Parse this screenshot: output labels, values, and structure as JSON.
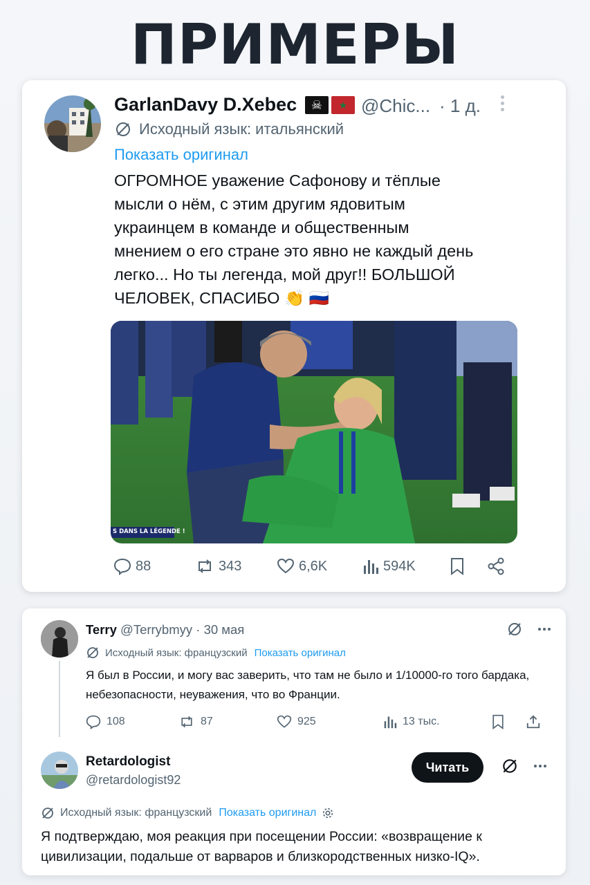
{
  "heading": "ПРИМЕРЫ",
  "tweet1": {
    "name": "GarlanDavy D.Xebec",
    "flags": [
      "pirate-flag-icon",
      "morocco-flag-icon"
    ],
    "handle": "@Chic...",
    "time": "· 1 д.",
    "translation_note": "Исходный язык: итальянский",
    "show_original": "Показать оригинал",
    "text": "ОГРОМНОЕ уважение Сафонову и тёплые мысли о нём, с этим другим ядовитым украинцем в команде и общественным мнением о его стране это явно не каждый день легко... Но ты легенда, мой друг!! БОЛЬШОЙ ЧЕЛОВЕК, СПАСИБО 👏 🇷🇺",
    "media_caption": "S DANS LA LÉGENDE !",
    "stats": {
      "replies": "88",
      "reposts": "343",
      "likes": "6,6K",
      "views": "594K"
    }
  },
  "reply_thread": {
    "parent": {
      "name": "Terry",
      "handle": "@Terrybmyy",
      "time": "· 30 мая",
      "translation_note": "Исходный язык: французский",
      "show_original": "Показать оригинал",
      "text": "Я был в России, и могу вас заверить, что там не было и 1/10000-го того бардака, небезопасности, неуважения, что во Франции.",
      "stats": {
        "replies": "108",
        "reposts": "87",
        "likes": "925",
        "views": "13 тыс."
      }
    },
    "reply": {
      "name": "Retardologist",
      "handle": "@retardologist92",
      "follow_label": "Читать",
      "translation_note": "Исходный язык: французский",
      "show_original": "Показать оригинал",
      "text": "Я подтверждаю, моя реакция при посещении России: «возвращение к цивилизации, подальше от варваров и близкородственных низко-IQ»."
    }
  },
  "colors": {
    "link": "#1d9bf0",
    "secondary_text": "#536471",
    "primary_text": "#0f1419",
    "follow_button": "#0f1419"
  }
}
